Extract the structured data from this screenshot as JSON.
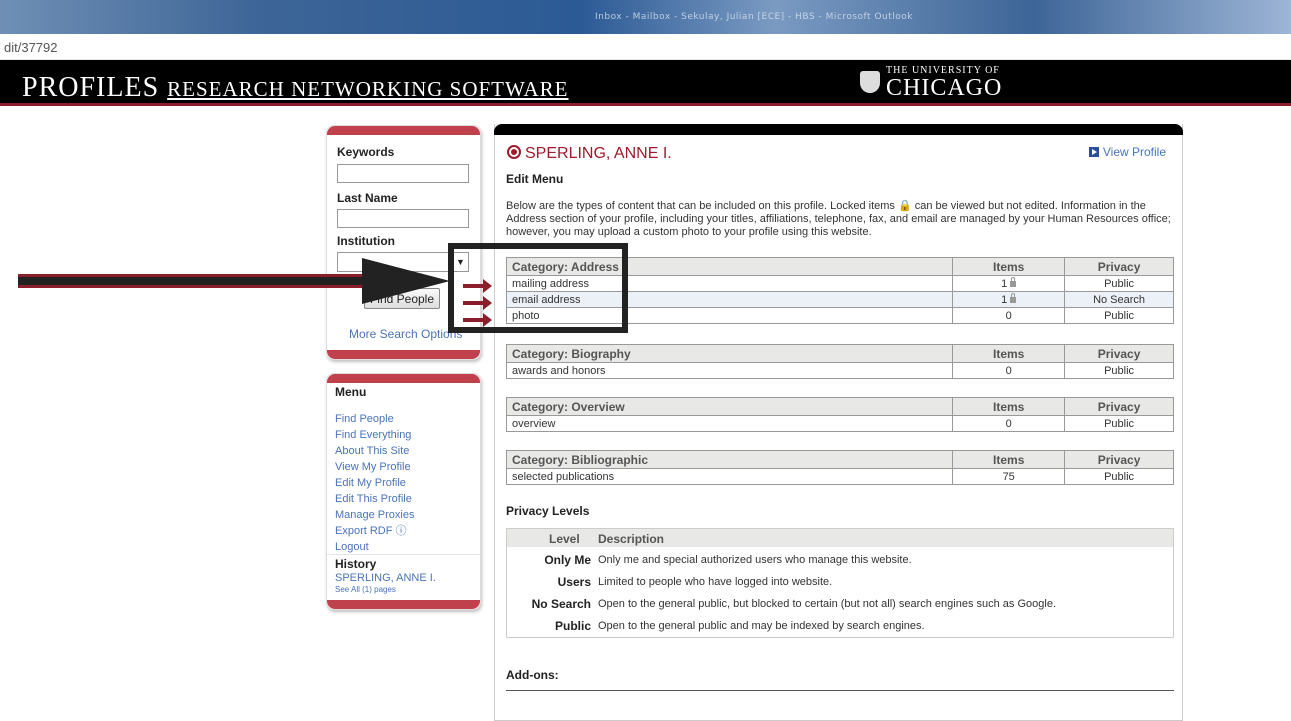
{
  "window": {
    "title": "Inbox - Mailbox - Sekulay, Julian [ECE] - HBS - Microsoft Outlook"
  },
  "address_bar": {
    "url": "dit/37792"
  },
  "header": {
    "brand_big": "PROFILES",
    "brand_rest": "RESEARCH NETWORKING SOFTWARE",
    "logo_line1": "THE UNIVERSITY OF",
    "logo_line2": "CHICAGO"
  },
  "search": {
    "keywords_label": "Keywords",
    "lastname_label": "Last Name",
    "institution_label": "Institution",
    "keywords_value": "",
    "lastname_value": "",
    "institution_value": "",
    "find_button": "Find People",
    "more_options": "More Search Options"
  },
  "menu": {
    "title": "Menu",
    "items": [
      "Find People",
      "Find Everything",
      "About This Site",
      "View My Profile",
      "Edit My Profile",
      "Edit This Profile",
      "Manage Proxies",
      "Export RDF ⓘ",
      "Logout"
    ],
    "history_title": "History",
    "history_item": "SPERLING, ANNE I.",
    "history_see_all": "See All (1) pages"
  },
  "profile": {
    "name": "SPERLING, ANNE I.",
    "view_profile": "View Profile",
    "edit_menu": "Edit Menu",
    "intro": "Below are the types of content that can be included on this profile. Locked items 🔒 can be viewed but not edited. Information in the Address section of your profile, including your titles, affiliations, telephone, fax, and email are managed by your Human Resources office; however, you may upload a custom photo to your profile using this website."
  },
  "columns": {
    "items": "Items",
    "privacy": "Privacy"
  },
  "categories": [
    {
      "title": "Category: Address",
      "rows": [
        {
          "name": "mailing address",
          "items": "1",
          "locked": true,
          "privacy": "Public"
        },
        {
          "name": "email address",
          "items": "1",
          "locked": true,
          "privacy": "No Search"
        },
        {
          "name": "photo",
          "items": "0",
          "locked": false,
          "privacy": "Public"
        }
      ]
    },
    {
      "title": "Category: Biography",
      "rows": [
        {
          "name": "awards and honors",
          "items": "0",
          "locked": false,
          "privacy": "Public"
        }
      ]
    },
    {
      "title": "Category: Overview",
      "rows": [
        {
          "name": "overview",
          "items": "0",
          "locked": false,
          "privacy": "Public"
        }
      ]
    },
    {
      "title": "Category: Bibliographic",
      "rows": [
        {
          "name": "selected publications",
          "items": "75",
          "locked": false,
          "privacy": "Public"
        }
      ]
    }
  ],
  "privacy_levels": {
    "title": "Privacy Levels",
    "col_level": "Level",
    "col_description": "Description",
    "rows": [
      {
        "level": "Only Me",
        "description": "Only me and special authorized users who manage this website."
      },
      {
        "level": "Users",
        "description": "Limited to people who have logged into website."
      },
      {
        "level": "No Search",
        "description": "Open to the general public, but blocked to certain (but not all) search engines such as Google."
      },
      {
        "level": "Public",
        "description": "Open to the general public and may be indexed by search engines."
      }
    ]
  },
  "addons_title": "Add-ons:",
  "colors": {
    "accent": "#a11a2b",
    "link": "#4a74b8",
    "header_bg": "#000000",
    "panel_cap": "#c0404c"
  }
}
